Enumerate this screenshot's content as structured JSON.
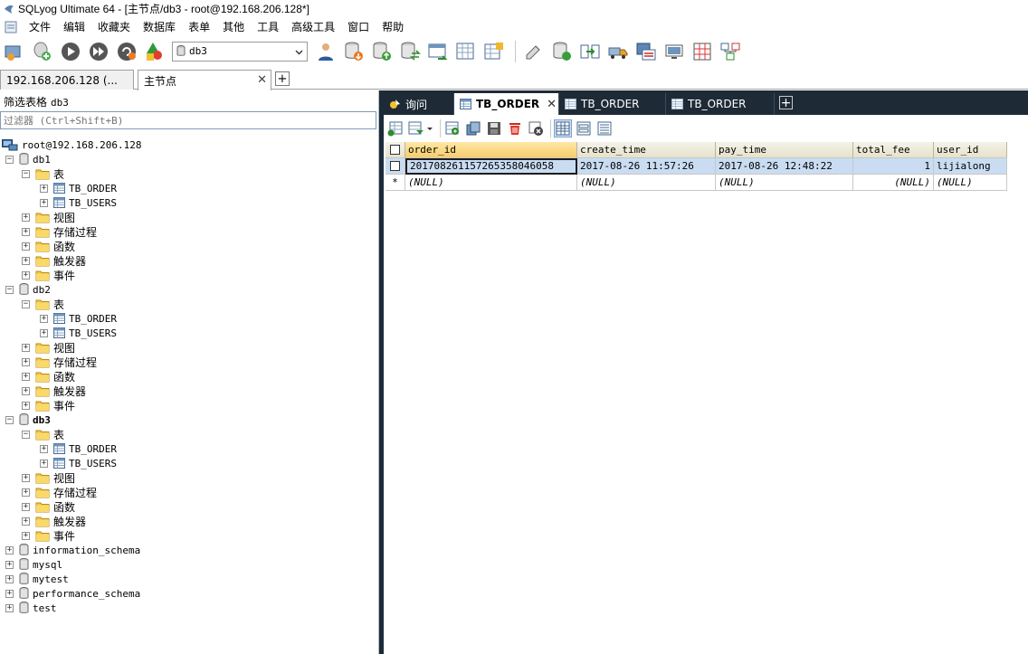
{
  "window": {
    "title": "SQLyog Ultimate 64 - [主节点/db3 - root@192.168.206.128*]"
  },
  "menu": [
    "文件",
    "编辑",
    "收藏夹",
    "数据库",
    "表单",
    "其他",
    "工具",
    "高级工具",
    "窗口",
    "帮助"
  ],
  "toolbar": {
    "db_selector": "db3"
  },
  "connection_tabs": [
    {
      "label": "192.168.206.128 (...",
      "active": false
    },
    {
      "label": "主节点",
      "active": true
    }
  ],
  "left": {
    "filter_label": "筛选表格",
    "filter_db": "db3",
    "filter_placeholder": "过滤器 (Ctrl+Shift+B)",
    "tree": {
      "root": "root@192.168.206.128",
      "db1": {
        "name": "db1",
        "tables": "表",
        "table_items": [
          "TB_ORDER",
          "TB_USERS"
        ],
        "views": "视图",
        "procs": "存储过程",
        "funcs": "函数",
        "triggers": "触发器",
        "events": "事件"
      },
      "db2": {
        "name": "db2",
        "tables": "表",
        "table_items": [
          "TB_ORDER",
          "TB_USERS"
        ],
        "views": "视图",
        "procs": "存储过程",
        "funcs": "函数",
        "triggers": "触发器",
        "events": "事件"
      },
      "db3": {
        "name": "db3",
        "tables": "表",
        "table_items": [
          "TB_ORDER",
          "TB_USERS"
        ],
        "views": "视图",
        "procs": "存储过程",
        "funcs": "函数",
        "triggers": "触发器",
        "events": "事件"
      },
      "other_dbs": [
        "information_schema",
        "mysql",
        "mytest",
        "performance_schema",
        "test"
      ]
    }
  },
  "right": {
    "doc_tabs": [
      {
        "label": "询问",
        "active": false
      },
      {
        "label": "TB_ORDER",
        "active": true
      },
      {
        "label": "TB_ORDER",
        "active": false
      },
      {
        "label": "TB_ORDER",
        "active": false
      }
    ],
    "grid": {
      "columns": [
        "order_id",
        "create_time",
        "pay_time",
        "total_fee",
        "user_id"
      ],
      "rows": [
        [
          "20170826115726535804605​8",
          "2017-08-26 11:57:26",
          "2017-08-26 12:48:22",
          "1",
          "lijialong"
        ]
      ],
      "new_row_marker": "*",
      "null_text": "(NULL)"
    }
  }
}
